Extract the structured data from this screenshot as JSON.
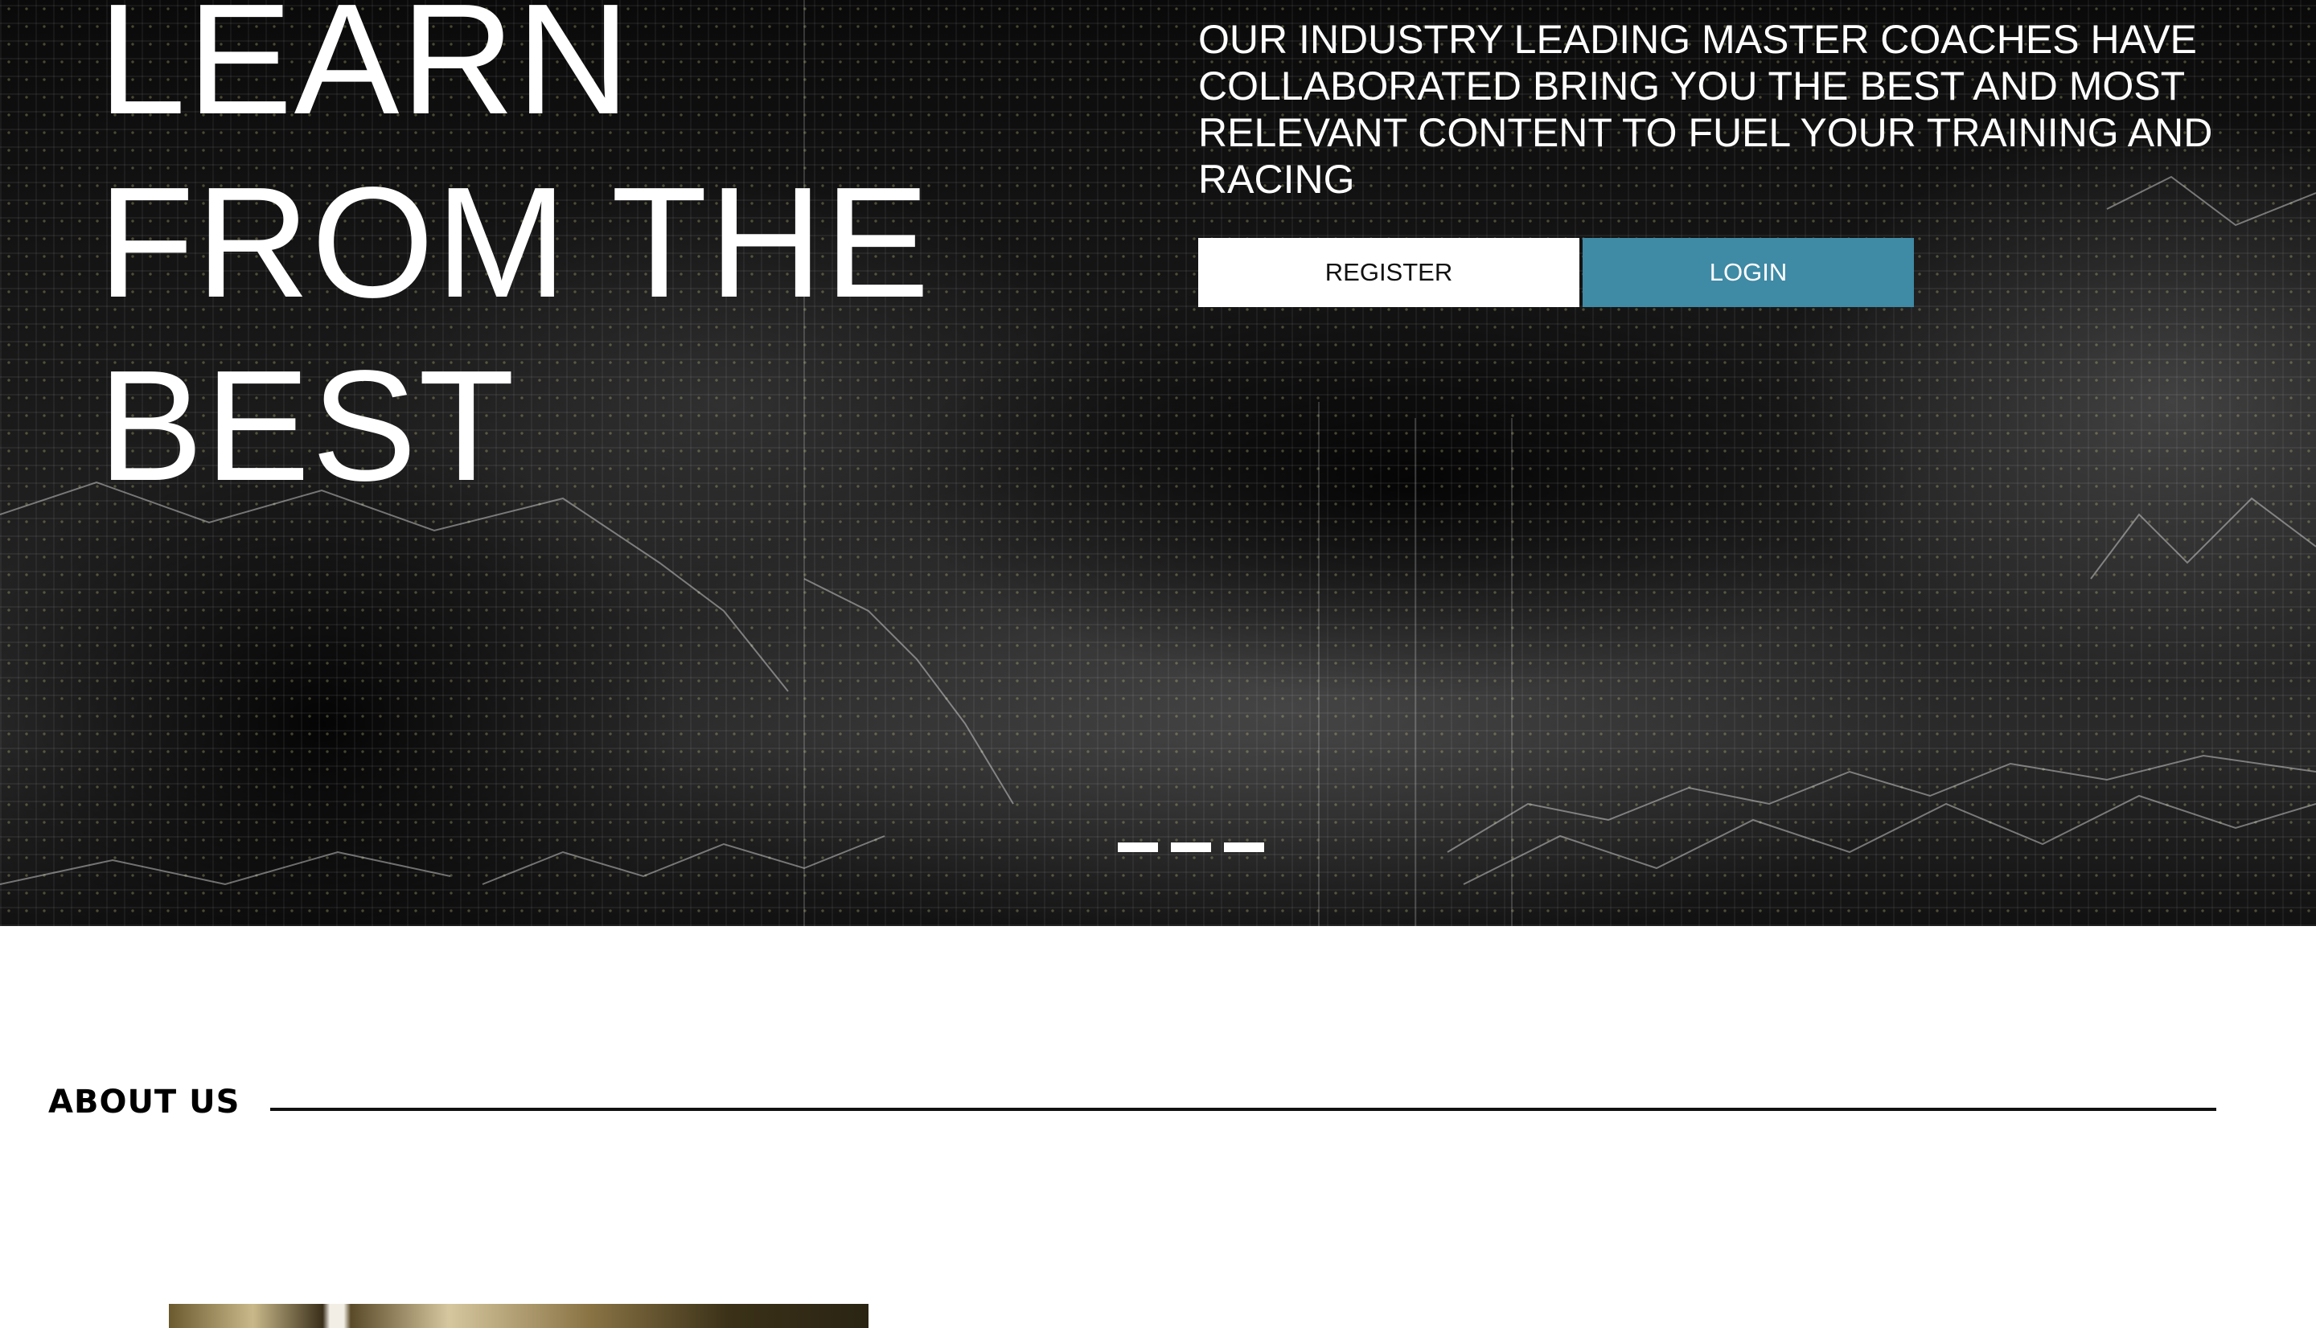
{
  "hero": {
    "title_lines": [
      "LEARN",
      "FROM THE",
      "BEST"
    ],
    "description": "OUR INDUSTRY LEADING MASTER COACHES HAVE COLLABORATED BRING YOU THE BEST AND MOST RELEVANT CONTENT TO FUEL YOUR TRAINING AND RACING",
    "register_label": "REGISTER",
    "login_label": "LOGIN",
    "login_color": "#3f8aa5",
    "slider": {
      "slide_count": 3,
      "active_index": 0
    }
  },
  "about": {
    "heading": "ABOUT US"
  }
}
